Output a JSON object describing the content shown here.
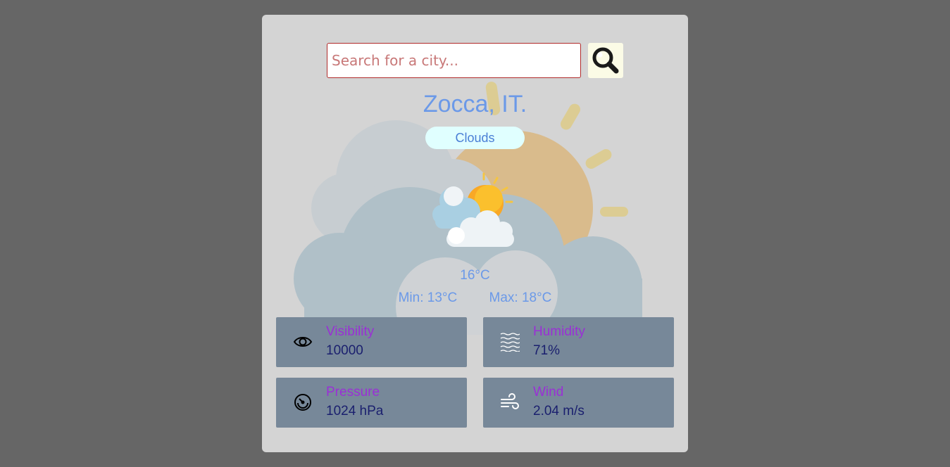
{
  "search": {
    "placeholder": "Search for a city...",
    "value": "",
    "button_icon": "search-magnifier-icon"
  },
  "location": {
    "city": "Zocca, IT."
  },
  "weather": {
    "condition": "Clouds",
    "icon": "sun-behind-clouds-icon",
    "temperature": "16°C",
    "min": "Min: 13°C",
    "max": "Max: 18°C"
  },
  "stats": [
    {
      "label": "Visibility",
      "value": "10000",
      "icon": "eye-icon"
    },
    {
      "label": "Humidity",
      "value": "71%",
      "icon": "waves-icon"
    },
    {
      "label": "Pressure",
      "value": "1024 hPa",
      "icon": "gauge-icon"
    },
    {
      "label": "Wind",
      "value": "2.04 m/s",
      "icon": "wind-icon"
    }
  ],
  "colors": {
    "page_background": "#666666",
    "card_background": "#d4d4d4",
    "accent_text": "#6b99e8",
    "stat_card": "#778899",
    "stat_label": "#9a2fd6",
    "stat_value": "#1a1f6e",
    "badge_background": "#e0ffff"
  }
}
